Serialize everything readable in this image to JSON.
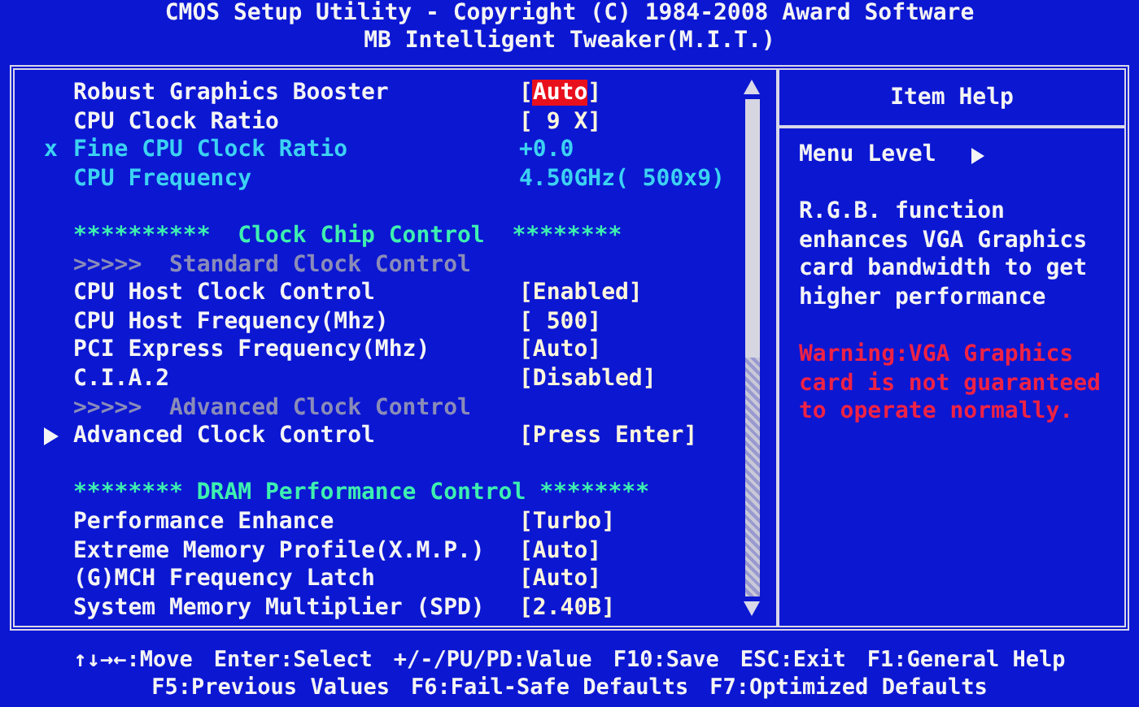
{
  "title": [
    "CMOS Setup Utility - Copyright (C) 1984-2008 Award Software",
    "MB Intelligent Tweaker(M.I.T.)"
  ],
  "rows": [
    {
      "kind": "setting",
      "label": "Robust Graphics Booster",
      "value": "[Auto]",
      "selected": true
    },
    {
      "kind": "setting",
      "label": "CPU Clock Ratio",
      "value": "[ 9 X]",
      "selected": false
    },
    {
      "kind": "locked",
      "marker": "x",
      "label": "Fine CPU Clock Ratio",
      "value": "+0.0"
    },
    {
      "kind": "info",
      "label": "CPU Frequency",
      "value": "4.50GHz( 500x9)"
    },
    {
      "kind": "blank"
    },
    {
      "kind": "header",
      "label": "**********  Clock Chip Control  ********"
    },
    {
      "kind": "subheader",
      "label": ">>>>>  Standard Clock Control"
    },
    {
      "kind": "setting",
      "label": "CPU Host Clock Control",
      "value": "[Enabled]",
      "selected": false
    },
    {
      "kind": "setting",
      "label": "CPU Host Frequency(Mhz)",
      "value": "[ 500]",
      "selected": false
    },
    {
      "kind": "setting",
      "label": "PCI Express Frequency(Mhz)",
      "value": "[Auto]",
      "selected": false
    },
    {
      "kind": "setting",
      "label": "C.I.A.2",
      "value": "[Disabled]",
      "selected": false
    },
    {
      "kind": "subheader",
      "label": ">>>>>  Advanced Clock Control"
    },
    {
      "kind": "submenu",
      "label": "Advanced Clock Control",
      "value": "[Press Enter]",
      "selected": false
    },
    {
      "kind": "blank"
    },
    {
      "kind": "header",
      "label": "******** DRAM Performance Control ********"
    },
    {
      "kind": "setting",
      "label": "Performance Enhance",
      "value": "[Turbo]",
      "selected": false
    },
    {
      "kind": "setting",
      "label": "Extreme Memory Profile(X.M.P.)",
      "value": "[Auto]",
      "selected": false
    },
    {
      "kind": "setting",
      "label": "(G)MCH Frequency Latch",
      "value": "[Auto]",
      "selected": false
    },
    {
      "kind": "setting",
      "label": "System Memory Multiplier (SPD)",
      "value": "[2.40B]",
      "selected": false
    }
  ],
  "help": {
    "title": "Item Help",
    "menu_level": "Menu Level",
    "description": "R.G.B. function enhances VGA Graphics card bandwidth to get higher performance",
    "warning": "Warning:VGA Graphics card is not guaranteed to operate normally."
  },
  "keys": [
    [
      "↑↓→←:Move",
      "Enter:Select",
      "+/-/PU/PD:Value",
      "F10:Save",
      "ESC:Exit",
      "F1:General Help"
    ],
    [
      "F5:Previous Values",
      "F6:Fail-Safe Defaults",
      "F7:Optimized Defaults"
    ]
  ]
}
